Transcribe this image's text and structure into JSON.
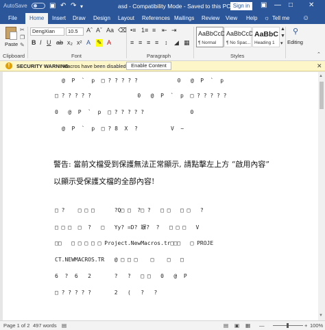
{
  "titlebar": {
    "autosave_label": "AutoSave",
    "autosave_state": "Off",
    "title": "asd  -  Compatibility Mode  -  Saved to this PC",
    "signin_label": "Sign in"
  },
  "tabs": [
    {
      "label": "File"
    },
    {
      "label": "Home",
      "active": true
    },
    {
      "label": "Insert"
    },
    {
      "label": "Draw"
    },
    {
      "label": "Design"
    },
    {
      "label": "Layout"
    },
    {
      "label": "References"
    },
    {
      "label": "Mailings"
    },
    {
      "label": "Review"
    },
    {
      "label": "View"
    },
    {
      "label": "Help"
    }
  ],
  "tell_me": "Tell me",
  "ribbon": {
    "paste_label": "Paste",
    "font_name": "DengXian",
    "font_size": "10.5",
    "groups": {
      "clipboard": "Clipboard",
      "font": "Font",
      "paragraph": "Paragraph",
      "styles": "Styles"
    },
    "styles": [
      {
        "sample": "AaBbCcDc",
        "name": "¶ Normal"
      },
      {
        "sample": "AaBbCcDc",
        "name": "¶ No Spac..."
      },
      {
        "sample": "AaBbC",
        "name": "Heading 1"
      }
    ],
    "editing_label": "Editing"
  },
  "security_bar": {
    "warning_title": "SECURITY WARNING",
    "message": "Macros have been disabled.",
    "button_label": "Enable Content"
  },
  "document": {
    "lines": [
      "@  P  `  p  □ ? ? ? ? ?            0   @  P  `  p",
      "□ ? ? ? ? ?              0   @  P  `  p  □ ? ? ? ? ?",
      "0   @  P  `  p  □ ? ? ? ? ?              0",
      "@  P  `  p  □ ? 8  X  ?          V  ~",
      "警告: 當前文檔受到保護無法正常顯示, 請點擊左上方 “啟用內容”",
      "以顯示受保護文檔的全部內容!",
      "□ ?    □ □ □      ?Q□ □  ?□ ?   □ □   □ □   ?",
      "□ □ □  □  ?   □   Yy? =D? 竮?  ?   □ □ □   V",
      "□□   □ □ □ □ □ Project.NewMacros.tr□□□   □ PROJE",
      "CT.NEWMACROS.TR   @ □ □ □    □    □   □",
      "6  ?  6   2       ?   ?   □ □   0   @  P",
      "□ ? ? ? ? ?       2   (   ?   ?"
    ]
  },
  "statusbar": {
    "page": "Page 1 of 2",
    "words": "497 words",
    "zoom": "100%"
  },
  "colors": {
    "accent": "#2b579a",
    "warning_bg": "#fdf6c9",
    "squiggle": "#4a7bd2"
  }
}
